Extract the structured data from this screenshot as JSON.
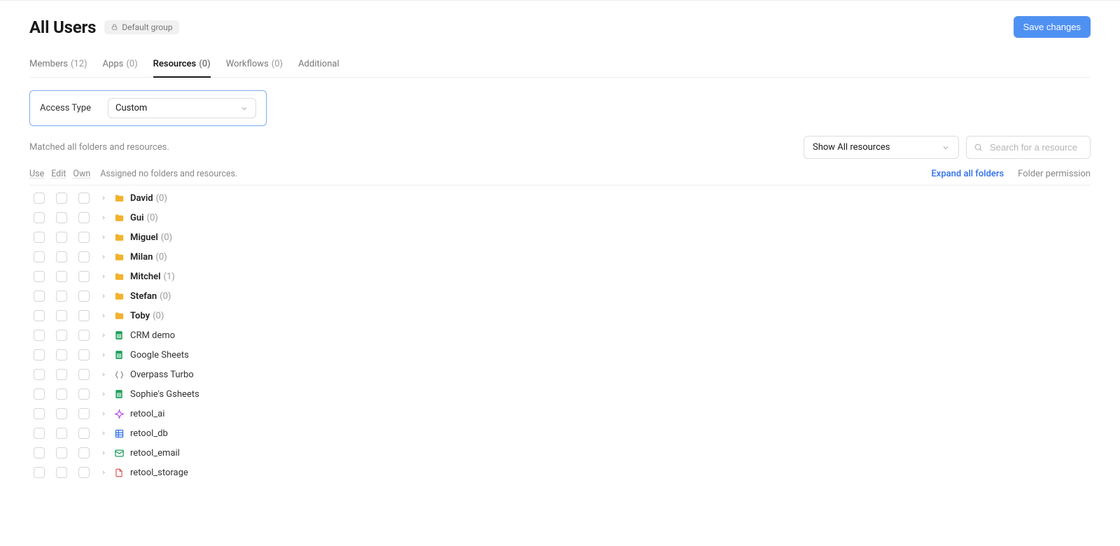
{
  "header": {
    "title": "All Users",
    "badge": "Default group",
    "save_button": "Save changes"
  },
  "tabs": [
    {
      "label": "Members",
      "count": "(12)",
      "active": false
    },
    {
      "label": "Apps",
      "count": "(0)",
      "active": false
    },
    {
      "label": "Resources",
      "count": "(0)",
      "active": true
    },
    {
      "label": "Workflows",
      "count": "(0)",
      "active": false
    },
    {
      "label": "Additional",
      "count": "",
      "active": false
    }
  ],
  "access": {
    "label": "Access Type",
    "value": "Custom"
  },
  "matched_text": "Matched all folders and resources.",
  "filter_select": "Show All resources",
  "search_placeholder": "Search for a resource",
  "columns": {
    "use": "Use",
    "edit": "Edit",
    "own": "Own"
  },
  "assigned_text": "Assigned no folders and resources.",
  "expand_link": "Expand all folders",
  "folder_perm_link": "Folder permission",
  "rows": [
    {
      "name": "David",
      "count": "(0)",
      "icon": "folder",
      "bold": true
    },
    {
      "name": "Gui",
      "count": "(0)",
      "icon": "folder",
      "bold": true
    },
    {
      "name": "Miguel",
      "count": "(0)",
      "icon": "folder",
      "bold": true
    },
    {
      "name": "Milan",
      "count": "(0)",
      "icon": "folder",
      "bold": true
    },
    {
      "name": "Mitchel",
      "count": "(1)",
      "icon": "folder",
      "bold": true
    },
    {
      "name": "Stefan",
      "count": "(0)",
      "icon": "folder",
      "bold": true
    },
    {
      "name": "Toby",
      "count": "(0)",
      "icon": "folder",
      "bold": true
    },
    {
      "name": "CRM demo",
      "count": "",
      "icon": "sheets",
      "bold": false
    },
    {
      "name": "Google Sheets",
      "count": "",
      "icon": "sheets",
      "bold": false
    },
    {
      "name": "Overpass Turbo",
      "count": "",
      "icon": "api",
      "bold": false
    },
    {
      "name": "Sophie's Gsheets",
      "count": "",
      "icon": "sheets",
      "bold": false
    },
    {
      "name": "retool_ai",
      "count": "",
      "icon": "ai",
      "bold": false
    },
    {
      "name": "retool_db",
      "count": "",
      "icon": "db",
      "bold": false
    },
    {
      "name": "retool_email",
      "count": "",
      "icon": "email",
      "bold": false
    },
    {
      "name": "retool_storage",
      "count": "",
      "icon": "storage",
      "bold": false
    }
  ]
}
